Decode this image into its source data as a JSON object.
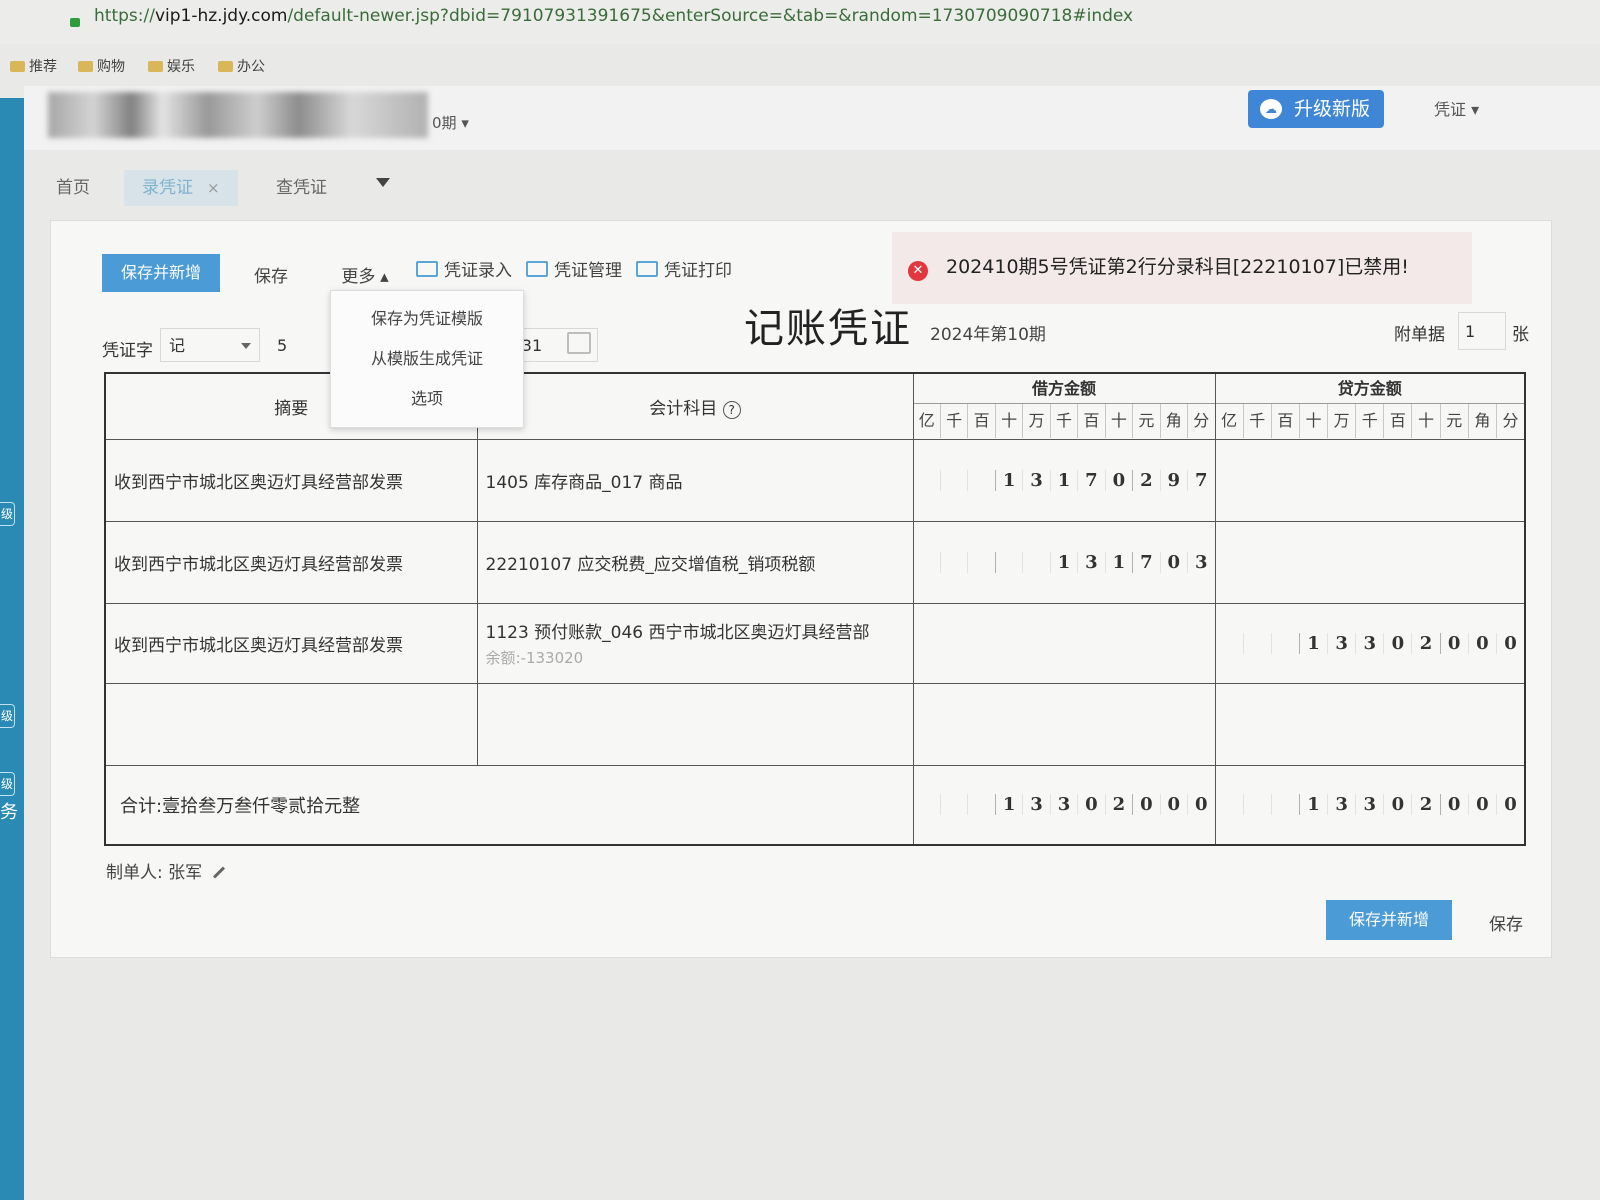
{
  "browser": {
    "url_prefix": "https://",
    "url_host": "vip1-hz.jdy.com",
    "url_rest": "/default-newer.jsp?dbid=79107931391675&enterSource=&tab=&random=1730709090718#index",
    "bookmarks": [
      "推荐",
      "购物",
      "娱乐",
      "办公"
    ]
  },
  "header": {
    "period": "0期",
    "upgrade_label": "升级新版",
    "menu_label": "凭证"
  },
  "tabs": [
    {
      "label": "首页"
    },
    {
      "label": "录凭证",
      "close": "×"
    },
    {
      "label": "查凭证"
    }
  ],
  "toolbar": {
    "save_new_label": "保存并新增",
    "save_label": "保存",
    "more_label": "更多",
    "entry_label": "凭证录入",
    "manage_label": "凭证管理",
    "print_label": "凭证打印"
  },
  "alert": {
    "message": "202410期5号凭证第2行分录科目[22210107]已禁用!"
  },
  "more_menu": [
    "保存为凭证模版",
    "从模版生成凭证",
    "选项"
  ],
  "voucher": {
    "word_label": "凭证字",
    "word_value": "记",
    "number_value": "5",
    "date_partial": "-31",
    "title": "记账凭证",
    "period_label": "2024年第10期",
    "attach_label": "附单据",
    "attach_value": "1",
    "attach_unit": "张",
    "col_summary": "摘要",
    "col_account": "会计科目",
    "col_debit": "借方金额",
    "col_credit": "贷方金额",
    "digit_units": [
      "亿",
      "千",
      "百",
      "十",
      "万",
      "千",
      "百",
      "十",
      "元",
      "角",
      "分"
    ],
    "rows": [
      {
        "summary": "收到西宁市城北区奥迈灯具经营部发票",
        "account": "1405 库存商品_017 商品",
        "balance": "",
        "debit": "1317029 7",
        "credit": ""
      },
      {
        "summary": "收到西宁市城北区奥迈灯具经营部发票",
        "account": "22210107 应交税费_应交增值税_销项税额",
        "balance": "",
        "debit": "131703",
        "credit": ""
      },
      {
        "summary": "收到西宁市城北区奥迈灯具经营部发票",
        "account": "1123 预付账款_046 西宁市城北区奥迈灯具经营部",
        "balance": "余额:-133020",
        "debit": "",
        "credit": "13302000"
      },
      {
        "summary": "",
        "account": "",
        "balance": "",
        "debit": "",
        "credit": ""
      }
    ],
    "total_label": "合计:壹拾叁万叁仟零贰拾元整",
    "total_debit": "13302000",
    "total_credit": "13302000",
    "maker_label": "制单人:",
    "maker_name": "张军"
  },
  "bottom": {
    "save_new_label": "保存并新增",
    "save_label": "保存"
  },
  "leftbar": {
    "labels": [
      "级",
      "级",
      "级",
      "务"
    ]
  }
}
